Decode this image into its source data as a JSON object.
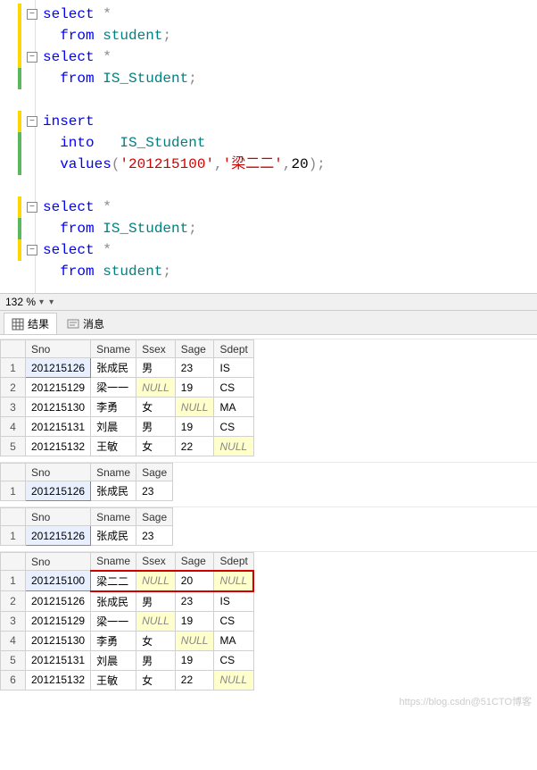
{
  "zoom": "132 %",
  "tabs": {
    "results": "结果",
    "messages": "消息"
  },
  "sql": {
    "select": "select",
    "star": "*",
    "from": "from",
    "student": "student",
    "is_student": "IS_Student",
    "insert": "insert",
    "into": "into",
    "values_kw": "values",
    "v1": "'201215100'",
    "v2": "'梁二二'",
    "v3": "20",
    "semi": ";",
    "lp": "(",
    "rp": ")",
    "comma": ","
  },
  "cols_main": [
    "Sno",
    "Sname",
    "Ssex",
    "Sage",
    "Sdept"
  ],
  "cols_is": [
    "Sno",
    "Sname",
    "Sage"
  ],
  "grid1": [
    {
      "n": "1",
      "Sno": "201215126",
      "Sname": "张成民",
      "Ssex": "男",
      "Sage": "23",
      "Sdept": "IS"
    },
    {
      "n": "2",
      "Sno": "201215129",
      "Sname": "梁一一",
      "Ssex": "NULL",
      "Sage": "19",
      "Sdept": "CS"
    },
    {
      "n": "3",
      "Sno": "201215130",
      "Sname": "李勇",
      "Ssex": "女",
      "Sage": "NULL",
      "Sdept": "MA"
    },
    {
      "n": "4",
      "Sno": "201215131",
      "Sname": "刘晨",
      "Ssex": "男",
      "Sage": "19",
      "Sdept": "CS"
    },
    {
      "n": "5",
      "Sno": "201215132",
      "Sname": "王敏",
      "Ssex": "女",
      "Sage": "22",
      "Sdept": "NULL"
    }
  ],
  "grid2": [
    {
      "n": "1",
      "Sno": "201215126",
      "Sname": "张成民",
      "Sage": "23"
    }
  ],
  "grid3": [
    {
      "n": "1",
      "Sno": "201215126",
      "Sname": "张成民",
      "Sage": "23"
    }
  ],
  "grid4": [
    {
      "n": "1",
      "Sno": "201215100",
      "Sname": "梁二二",
      "Ssex": "NULL",
      "Sage": "20",
      "Sdept": "NULL",
      "hl": true
    },
    {
      "n": "2",
      "Sno": "201215126",
      "Sname": "张成民",
      "Ssex": "男",
      "Sage": "23",
      "Sdept": "IS"
    },
    {
      "n": "3",
      "Sno": "201215129",
      "Sname": "梁一一",
      "Ssex": "NULL",
      "Sage": "19",
      "Sdept": "CS"
    },
    {
      "n": "4",
      "Sno": "201215130",
      "Sname": "李勇",
      "Ssex": "女",
      "Sage": "NULL",
      "Sdept": "MA"
    },
    {
      "n": "5",
      "Sno": "201215131",
      "Sname": "刘晨",
      "Ssex": "男",
      "Sage": "19",
      "Sdept": "CS"
    },
    {
      "n": "6",
      "Sno": "201215132",
      "Sname": "王敏",
      "Ssex": "女",
      "Sage": "22",
      "Sdept": "NULL"
    }
  ],
  "watermark": "https://blog.csdn@51CTO博客"
}
